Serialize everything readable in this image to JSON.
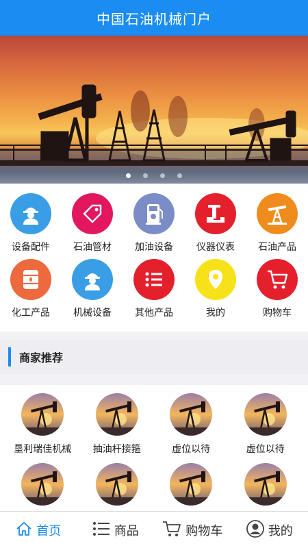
{
  "header": {
    "title": "中国石油机械门户"
  },
  "banner": {
    "slides": 4,
    "active": 0
  },
  "categories": [
    {
      "label": "设备配件",
      "color": "#3a9ee6",
      "icon": "worker-icon"
    },
    {
      "label": "石油管材",
      "color": "#e2175f",
      "icon": "tag-icon"
    },
    {
      "label": "加油设备",
      "color": "#7c8cc7",
      "icon": "fuel-pump-icon"
    },
    {
      "label": "仪器仪表",
      "color": "#e5202d",
      "icon": "instrument-icon"
    },
    {
      "label": "石油产品",
      "color": "#f08c1d",
      "icon": "oil-derrick-icon"
    },
    {
      "label": "化工产品",
      "color": "#ec6a3e",
      "icon": "barrel-icon"
    },
    {
      "label": "机械设备",
      "color": "#3a9ee6",
      "icon": "worker-icon"
    },
    {
      "label": "其他产品",
      "color": "#e5202d",
      "icon": "list-icon"
    },
    {
      "label": "我的",
      "color": "#f7e21a",
      "icon": "location-pin-icon"
    },
    {
      "label": "购物车",
      "color": "#e5202d",
      "icon": "cart-icon"
    }
  ],
  "section": {
    "title": "商家推荐"
  },
  "merchants": [
    {
      "name": "垦利瑞佳机械"
    },
    {
      "name": "抽油杆接箍"
    },
    {
      "name": "虚位以待"
    },
    {
      "name": "虚位以待"
    },
    {
      "name": ""
    },
    {
      "name": ""
    },
    {
      "name": ""
    },
    {
      "name": ""
    }
  ],
  "tabbar": [
    {
      "label": "首页",
      "icon": "home-icon",
      "active": true
    },
    {
      "label": "商品",
      "icon": "list-icon",
      "active": false
    },
    {
      "label": "购物车",
      "icon": "cart-icon",
      "active": false
    },
    {
      "label": "我的",
      "icon": "user-icon",
      "active": false
    }
  ],
  "colors": {
    "brand": "#1a8cf2"
  }
}
